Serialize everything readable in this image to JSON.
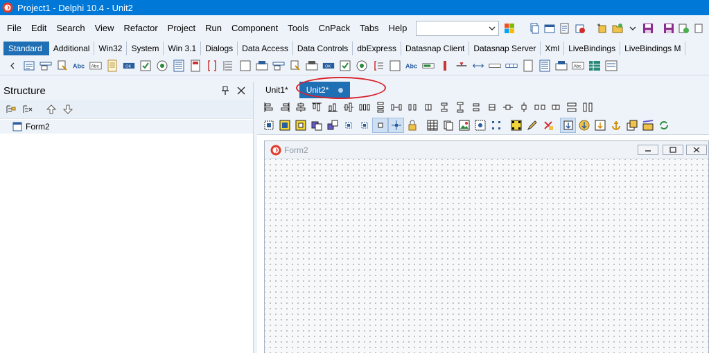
{
  "window": {
    "title": "Project1 - Delphi 10.4 - Unit2"
  },
  "menu": [
    "File",
    "Edit",
    "Search",
    "View",
    "Refactor",
    "Project",
    "Run",
    "Component",
    "Tools",
    "CnPack",
    "Tabs",
    "Help"
  ],
  "toolbar": {
    "combo_value": ""
  },
  "palette": {
    "tabs": [
      "Standard",
      "Additional",
      "Win32",
      "System",
      "Win 3.1",
      "Dialogs",
      "Data Access",
      "Data Controls",
      "dbExpress",
      "Datasnap Client",
      "Datasnap Server",
      "Xml",
      "LiveBindings",
      "LiveBindings M"
    ],
    "active_tab": "Standard"
  },
  "structure": {
    "title": "Structure",
    "tree": [
      {
        "label": "Form2"
      }
    ]
  },
  "editor": {
    "tabs": [
      {
        "label": "Unit1*",
        "active": false
      },
      {
        "label": "Unit2*",
        "active": true
      }
    ]
  },
  "form": {
    "caption": "Form2"
  },
  "colors": {
    "titlebar": "#0078d7",
    "active_tab": "#1f6fb5",
    "annotation_circle": "#d9232e"
  }
}
